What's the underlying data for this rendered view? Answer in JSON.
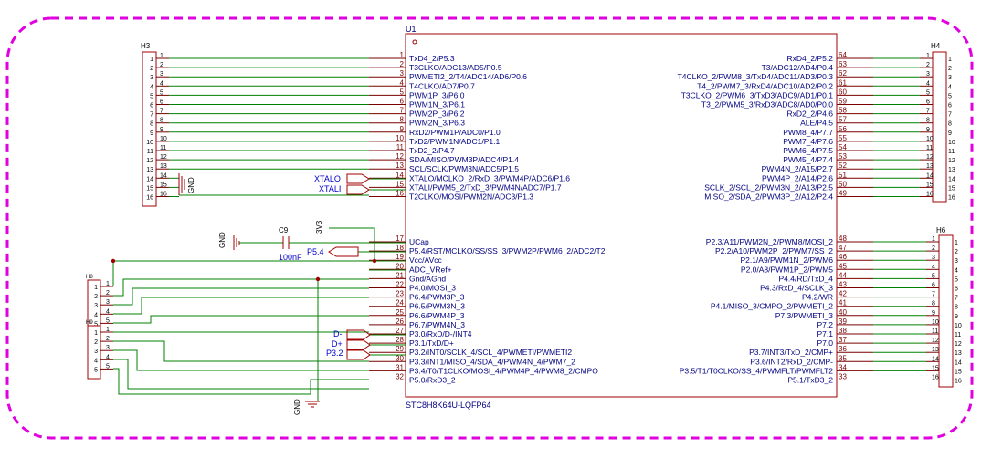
{
  "u1": {
    "designator": "U1",
    "part": "STC8H8K64U-LQFP64",
    "left_top": [
      {
        "n": "1",
        "name": "TxD4_2/P5.3"
      },
      {
        "n": "2",
        "name": "T3CLKO/ADC13/AD5/P0.5"
      },
      {
        "n": "3",
        "name": "PWMETI2_2/T4/ADC14/AD6/P0.6"
      },
      {
        "n": "4",
        "name": "T4CLKO/AD7/P0.7"
      },
      {
        "n": "5",
        "name": "PWM1P_3/P6.0"
      },
      {
        "n": "6",
        "name": "PWM1N_3/P6.1"
      },
      {
        "n": "7",
        "name": "PWM2P_3/P6.2"
      },
      {
        "n": "8",
        "name": "PWM2N_3/P6.3"
      },
      {
        "n": "9",
        "name": "RxD2/PWM1P/ADC0/P1.0"
      },
      {
        "n": "10",
        "name": "TxD2/PWM1N/ADC1/P1.1"
      },
      {
        "n": "11",
        "name": "TxD2_2/P4.7"
      },
      {
        "n": "12",
        "name": "SDA/MISO/PWM3P/ADC4/P1.4"
      },
      {
        "n": "13",
        "name": "SCL/SCLK/PWM3N/ADC5/P1.5"
      },
      {
        "n": "14",
        "name": "XTALO/MCLKO_2/RxD_3/PWM4P/ADC6/P1.6"
      },
      {
        "n": "15",
        "name": "XTALI/PWM5_2/TxD_3/PWM4N/ADC7/P1.7"
      },
      {
        "n": "16",
        "name": "T2CLKO/MOSI/PWM2N/ADC3/P1.3"
      }
    ],
    "left_bottom": [
      {
        "n": "17",
        "name": "UCap"
      },
      {
        "n": "18",
        "name": "P5.4/RST/MCLKO/SS/SS_3/PWM2P/PWM6_2/ADC2/T2"
      },
      {
        "n": "19",
        "name": "Vcc/AVcc"
      },
      {
        "n": "20",
        "name": "ADC_VRef+"
      },
      {
        "n": "21",
        "name": "Gnd/AGnd"
      },
      {
        "n": "22",
        "name": "P4.0/MOSI_3"
      },
      {
        "n": "23",
        "name": "P6.4/PWM3P_3"
      },
      {
        "n": "24",
        "name": "P6.5/PWM3N_3"
      },
      {
        "n": "25",
        "name": "P6.6/PWM4P_3"
      },
      {
        "n": "26",
        "name": "P6.7/PWM4N_3"
      },
      {
        "n": "27",
        "name": "P3.0/RxD/D-/INT4"
      },
      {
        "n": "28",
        "name": "P3.1/TxD/D+"
      },
      {
        "n": "29",
        "name": "P3.2/INT0/SCLK_4/SCL_4/PWMETI/PWMETI2"
      },
      {
        "n": "30",
        "name": "P3.3/INT1/MISO_4/SDA_4/PWM4N_4/PWM7_2"
      },
      {
        "n": "31",
        "name": "P3.4/T0/T1CLKO/MOSI_4/PWM4P_4/PWM8_2/CMPO"
      },
      {
        "n": "32",
        "name": "P5.0/RxD3_2"
      }
    ],
    "right_top": [
      {
        "n": "64",
        "name": "RxD4_2/P5.2"
      },
      {
        "n": "63",
        "name": "T3/ADC12/AD4/P0.4"
      },
      {
        "n": "62",
        "name": "T4CLKO_2/PWM8_3/TxD4/ADC11/AD3/P0.3"
      },
      {
        "n": "61",
        "name": "T4_2/PWM7_3/RxD4/ADC10/AD2/P0.2"
      },
      {
        "n": "60",
        "name": "T3CLKO_2/PWM6_3/TxD3/ADC9/AD1/P0.1"
      },
      {
        "n": "59",
        "name": "T3_2/PWM5_3/RxD3/ADC8/AD0/P0.0"
      },
      {
        "n": "58",
        "name": "RxD2_2/P4.6"
      },
      {
        "n": "57",
        "name": "ALE/P4.5"
      },
      {
        "n": "56",
        "name": "PWM8_4/P7.7"
      },
      {
        "n": "55",
        "name": "PWM7_4/P7.6"
      },
      {
        "n": "54",
        "name": "PWM6_4/P7.5"
      },
      {
        "n": "53",
        "name": "PWM5_4/P7.4"
      },
      {
        "n": "52",
        "name": "PWM4N_2/A15/P2.7"
      },
      {
        "n": "51",
        "name": "PWM4P_2/A14/P2.6"
      },
      {
        "n": "50",
        "name": "SCLK_2/SCL_2/PWM3N_2/A13/P2.5"
      },
      {
        "n": "49",
        "name": "MISO_2/SDA_2/PWM3P_2/A12/P2.4"
      }
    ],
    "right_bottom": [
      {
        "n": "48",
        "name": "P2.3/A11/PWM2N_2/PWM8/MOSI_2"
      },
      {
        "n": "47",
        "name": "P2.2/A10/PWM2P_2/PWM7/SS_2"
      },
      {
        "n": "46",
        "name": "P2.1/A9/PWM1N_2/PWM6"
      },
      {
        "n": "45",
        "name": "P2.0/A8/PWM1P_2/PWM5"
      },
      {
        "n": "44",
        "name": "P4.4/RD/TxD_4"
      },
      {
        "n": "43",
        "name": "P4.3/RxD_4/SCLK_3"
      },
      {
        "n": "42",
        "name": "P4.2/WR"
      },
      {
        "n": "41",
        "name": "P4.1/MISO_3/CMPO_2/PWMETI_2"
      },
      {
        "n": "40",
        "name": "P7.3/PWMETI_3"
      },
      {
        "n": "39",
        "name": "P7.2"
      },
      {
        "n": "38",
        "name": "P7.1"
      },
      {
        "n": "37",
        "name": "P7.0"
      },
      {
        "n": "36",
        "name": "P3.7/INT3/TxD_2/CMP+"
      },
      {
        "n": "35",
        "name": "P3.6/INT2/RxD_2/CMP-"
      },
      {
        "n": "34",
        "name": "P3.5/T1/T0CLKO/SS_4/PWMFLT/PWMFLT2"
      },
      {
        "n": "33",
        "name": "P5.1/TxD3_2"
      }
    ]
  },
  "headers": {
    "h3": {
      "name": "H3",
      "pins": [
        "1",
        "2",
        "3",
        "4",
        "5",
        "6",
        "7",
        "8",
        "9",
        "10",
        "11",
        "12",
        "13",
        "14",
        "15",
        "16"
      ]
    },
    "h4": {
      "name": "H4",
      "pins": [
        "1",
        "2",
        "3",
        "4",
        "5",
        "6",
        "7",
        "8",
        "9",
        "10",
        "11",
        "12",
        "13",
        "14",
        "15",
        "16"
      ]
    },
    "h6": {
      "name": "H6",
      "pins": [
        "1",
        "2",
        "3",
        "4",
        "5",
        "6",
        "7",
        "8",
        "9",
        "10",
        "11",
        "12",
        "13",
        "14",
        "15",
        "16"
      ]
    },
    "h8": {
      "name": "H8",
      "pins": [
        "1",
        "2",
        "3",
        "4",
        "5"
      ]
    },
    "h9": {
      "name": "H9",
      "pins": [
        "1",
        "2",
        "3",
        "4",
        "5"
      ]
    }
  },
  "h3_outer_nums": [
    "1",
    "2",
    "3",
    "4",
    "5",
    "6",
    "7",
    "8",
    "9",
    "10",
    "11",
    "12",
    "13",
    "14",
    "15",
    "16"
  ],
  "h6_outer_nums": [
    "1",
    "2",
    "3",
    "4",
    "5",
    "6",
    "7",
    "8",
    "9",
    "10",
    "11",
    "12",
    "13",
    "14",
    "15",
    "16"
  ],
  "h4_outer_nums": [
    "1",
    "2",
    "3",
    "4",
    "5",
    "6",
    "7",
    "8",
    "9",
    "10",
    "11",
    "12",
    "13",
    "14",
    "15",
    "16"
  ],
  "h8_outer_nums": [
    "1",
    "2",
    "3",
    "4",
    "5"
  ],
  "h9_outer_nums": [
    "1",
    "2",
    "3",
    "4",
    "5"
  ],
  "net_labels": {
    "xtalo": "XTALO",
    "xtali": "XTALI",
    "p54": "P5.4",
    "dminus": "D-",
    "dplus": "D+",
    "p32": "P3.2",
    "v3v3": "3V3"
  },
  "capacitor": {
    "designator": "C9",
    "value": "100nF"
  },
  "gnd_labels": {
    "gnd_a": "GND",
    "gnd_b": "GND",
    "gnd_c": "GND"
  },
  "colors": {
    "wire": "#008000",
    "pin": "#7a0000",
    "body": "#a00000",
    "text": "#000080",
    "label": "#0000cc",
    "border": "#e000e0"
  }
}
